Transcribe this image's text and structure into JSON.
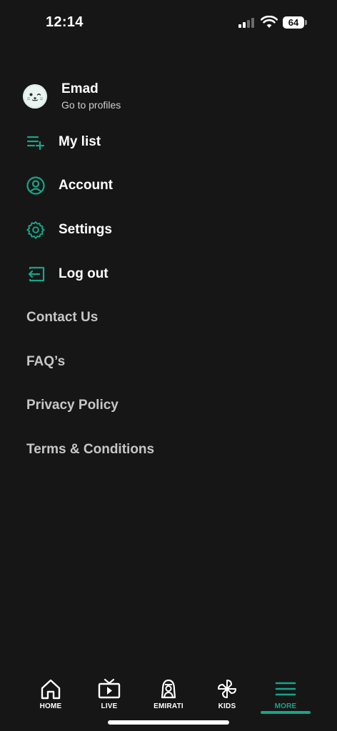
{
  "status_bar": {
    "time": "12:14",
    "battery": "64"
  },
  "profile": {
    "name": "Emad",
    "subtitle": "Go to profiles"
  },
  "menu": [
    {
      "label": "My list",
      "icon": "list-add-icon"
    },
    {
      "label": "Account",
      "icon": "user-circle-icon"
    },
    {
      "label": "Settings",
      "icon": "gear-icon"
    },
    {
      "label": "Log out",
      "icon": "logout-icon"
    }
  ],
  "links": [
    {
      "label": "Contact Us"
    },
    {
      "label": "FAQ’s"
    },
    {
      "label": "Privacy Policy"
    },
    {
      "label": "Terms & Conditions"
    }
  ],
  "bottom_nav": [
    {
      "label": "HOME",
      "icon": "home-icon"
    },
    {
      "label": "LIVE",
      "icon": "tv-play-icon"
    },
    {
      "label": "EMIRATI",
      "icon": "emirati-figure-icon"
    },
    {
      "label": "KIDS",
      "icon": "pinwheel-icon"
    },
    {
      "label": "MORE",
      "icon": "menu-icon",
      "active": true
    }
  ],
  "colors": {
    "background": "#161616",
    "accent": "#17a58a",
    "text_primary": "#ffffff",
    "text_secondary": "#c7c7c7"
  }
}
